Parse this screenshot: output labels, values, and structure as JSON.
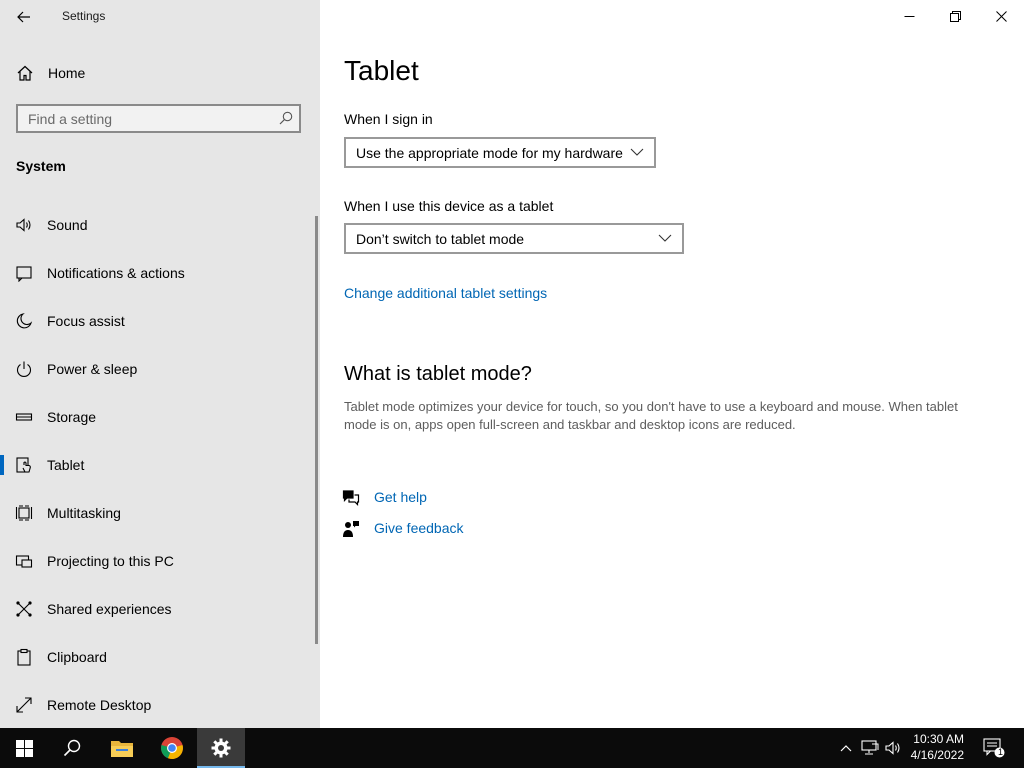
{
  "window": {
    "app_title": "Settings"
  },
  "sidebar": {
    "home_label": "Home",
    "search_placeholder": "Find a setting",
    "section_label": "System",
    "items": [
      {
        "label": "Sound",
        "icon": "speaker-icon",
        "selected": false
      },
      {
        "label": "Notifications & actions",
        "icon": "notification-icon",
        "selected": false
      },
      {
        "label": "Focus assist",
        "icon": "moon-icon",
        "selected": false
      },
      {
        "label": "Power & sleep",
        "icon": "power-icon",
        "selected": false
      },
      {
        "label": "Storage",
        "icon": "storage-icon",
        "selected": false
      },
      {
        "label": "Tablet",
        "icon": "tablet-icon",
        "selected": true
      },
      {
        "label": "Multitasking",
        "icon": "multitasking-icon",
        "selected": false
      },
      {
        "label": "Projecting to this PC",
        "icon": "projecting-icon",
        "selected": false
      },
      {
        "label": "Shared experiences",
        "icon": "shared-experiences-icon",
        "selected": false
      },
      {
        "label": "Clipboard",
        "icon": "clipboard-icon",
        "selected": false
      },
      {
        "label": "Remote Desktop",
        "icon": "remote-desktop-icon",
        "selected": false
      }
    ]
  },
  "main": {
    "title": "Tablet",
    "signin_label": "When I sign in",
    "signin_value": "Use the appropriate mode for my hardware",
    "tablet_label": "When I use this device as a tablet",
    "tablet_value": "Don’t switch to tablet mode",
    "additional_link": "Change additional tablet settings",
    "what_heading": "What is tablet mode?",
    "what_desc": "Tablet mode optimizes your device for touch, so you don't have to use a keyboard and mouse. When tablet mode is on, apps open full-screen and taskbar and desktop icons are reduced.",
    "get_help": "Get help",
    "give_feedback": "Give feedback"
  },
  "taskbar": {
    "time": "10:30 AM",
    "date": "4/16/2022",
    "notification_count": "1"
  },
  "colors": {
    "accent": "#0067c0",
    "link": "#0066b4",
    "sidebar_bg": "#e6e6e6",
    "taskbar_bg": "#0b0b0b"
  }
}
